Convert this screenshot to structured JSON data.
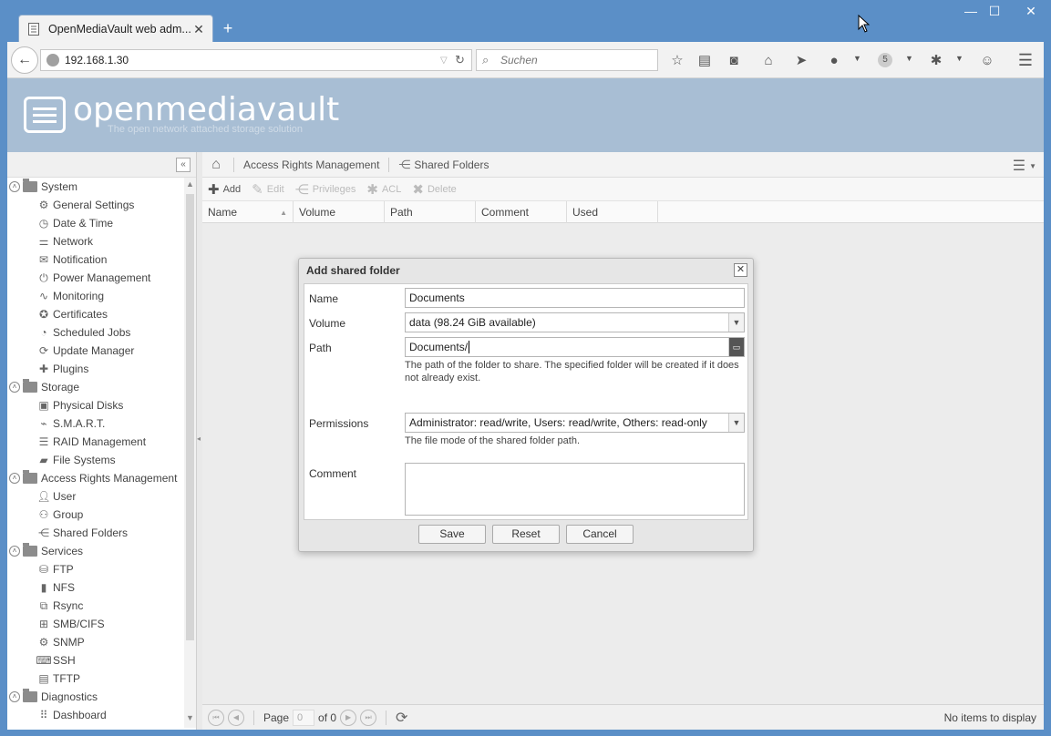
{
  "browser": {
    "tab_title": "OpenMediaVault web adm...",
    "url": "192.168.1.30",
    "search_placeholder": "Suchen",
    "badge_count": "5"
  },
  "header": {
    "logo_text": "openmediavault",
    "tagline": "The open network attached storage solution"
  },
  "sidebar": {
    "categories": [
      {
        "label": "System",
        "items": [
          "General Settings",
          "Date & Time",
          "Network",
          "Notification",
          "Power Management",
          "Monitoring",
          "Certificates",
          "Scheduled Jobs",
          "Update Manager",
          "Plugins"
        ]
      },
      {
        "label": "Storage",
        "items": [
          "Physical Disks",
          "S.M.A.R.T.",
          "RAID Management",
          "File Systems"
        ]
      },
      {
        "label": "Access Rights Management",
        "items": [
          "User",
          "Group",
          "Shared Folders"
        ]
      },
      {
        "label": "Services",
        "items": [
          "FTP",
          "NFS",
          "Rsync",
          "SMB/CIFS",
          "SNMP",
          "SSH",
          "TFTP"
        ]
      },
      {
        "label": "Diagnostics",
        "items": [
          "Dashboard"
        ]
      }
    ]
  },
  "breadcrumb": {
    "section": "Access Rights Management",
    "page": "Shared Folders"
  },
  "toolbar": {
    "add": "Add",
    "edit": "Edit",
    "privileges": "Privileges",
    "acl": "ACL",
    "delete": "Delete"
  },
  "grid": {
    "columns": [
      "Name",
      "Volume",
      "Path",
      "Comment",
      "Used"
    ]
  },
  "pager": {
    "page_label": "Page",
    "page_value": "0",
    "of_label": "of 0",
    "status": "No items to display"
  },
  "dialog": {
    "title": "Add shared folder",
    "name_label": "Name",
    "name_value": "Documents",
    "volume_label": "Volume",
    "volume_value": "data (98.24 GiB available)",
    "path_label": "Path",
    "path_value": "Documents/",
    "path_help": "The path of the folder to share. The specified folder will be created if it does not already exist.",
    "permissions_label": "Permissions",
    "permissions_value": "Administrator: read/write, Users: read/write, Others: read-only",
    "permissions_help": "The file mode of the shared folder path.",
    "comment_label": "Comment",
    "comment_value": "",
    "save": "Save",
    "reset": "Reset",
    "cancel": "Cancel"
  },
  "colors": {
    "window_frame": "#5b8fc7",
    "header_bg": "#a8bed4",
    "panel_bg": "#ececec"
  }
}
